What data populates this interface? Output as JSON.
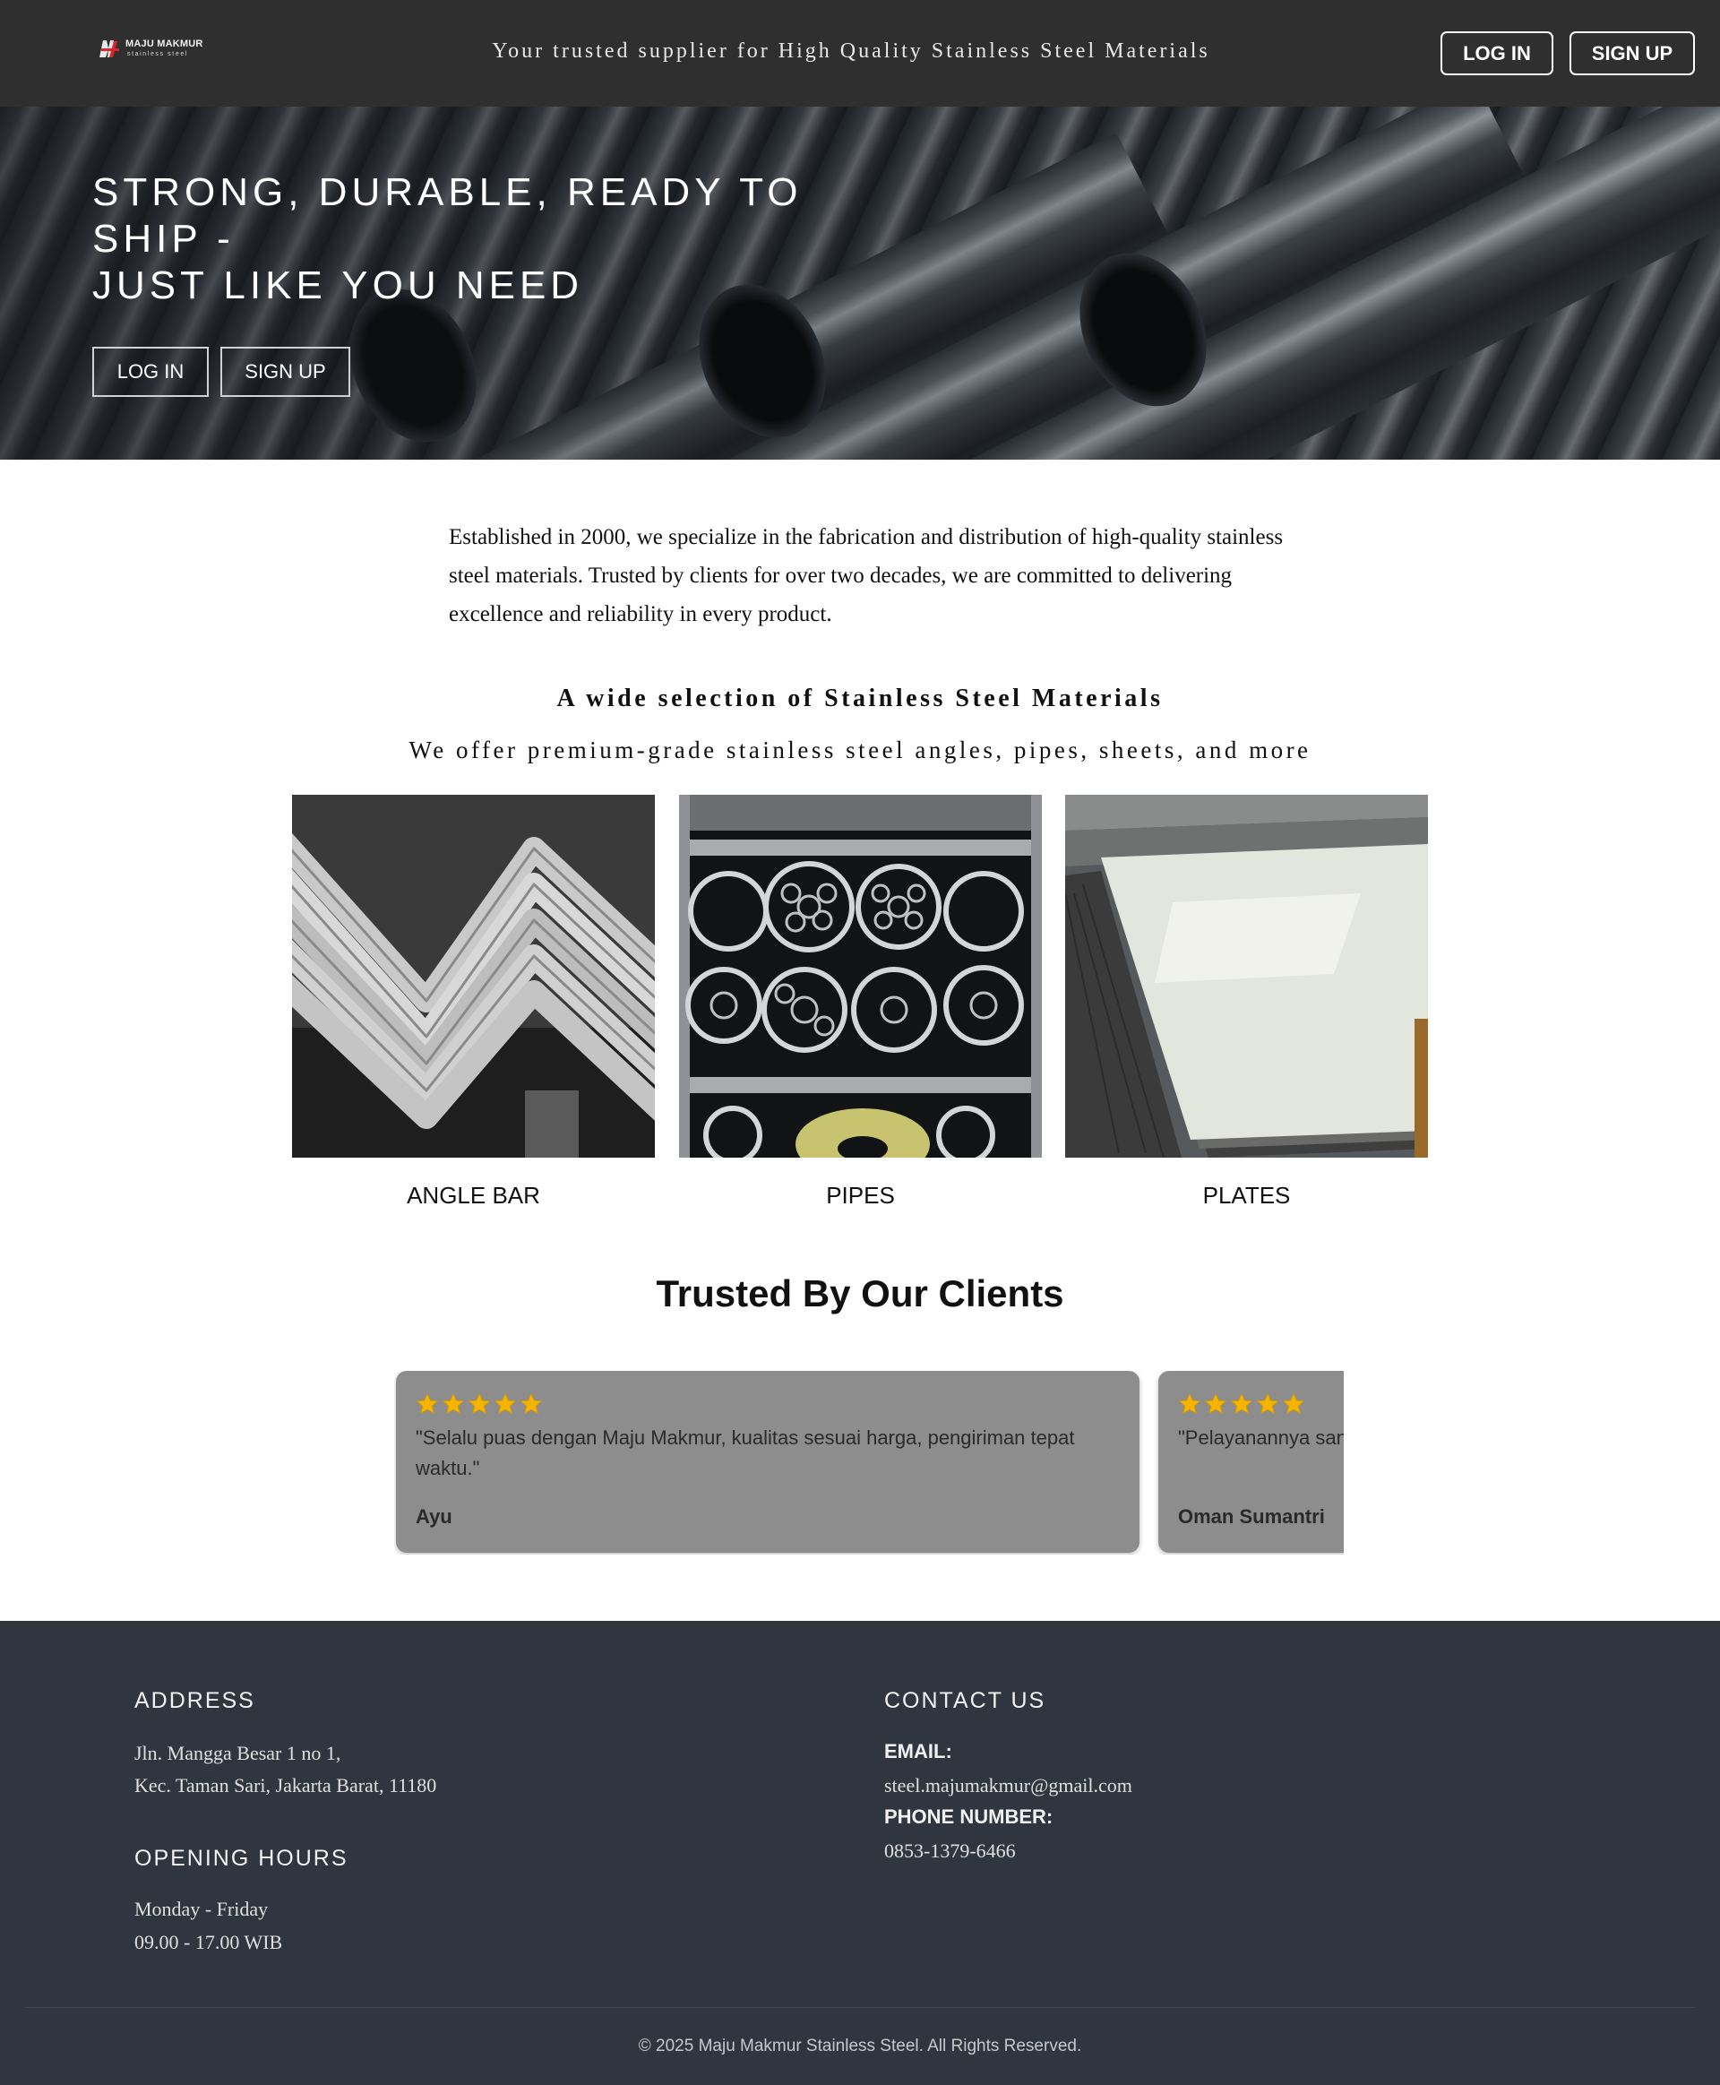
{
  "header": {
    "logo_brand": "MAJU MAKMUR",
    "logo_sub": "stainless steel",
    "tagline": "Your trusted supplier for High Quality Stainless Steel Materials",
    "login_label": "LOG IN",
    "signup_label": "SIGN UP"
  },
  "hero": {
    "headline_line1": "STRONG, DURABLE, READY TO",
    "headline_line2": "SHIP -",
    "headline_line3": "JUST LIKE YOU NEED",
    "login_label": "LOG IN",
    "signup_label": "SIGN UP"
  },
  "intro": {
    "text": "Established in 2000, we specialize in the fabrication and distribution of high-quality stainless steel materials. Trusted by clients for over two decades, we are committed to delivering excellence and reliability in every product."
  },
  "selection": {
    "title": "A wide selection of Stainless Steel Materials",
    "subtitle": "We offer premium-grade stainless steel angles, pipes, sheets, and more"
  },
  "products": [
    {
      "label": "ANGLE BAR"
    },
    {
      "label": "PIPES"
    },
    {
      "label": "PLATES"
    }
  ],
  "testimonials": {
    "title": "Trusted By Our Clients",
    "items": [
      {
        "rating": 5,
        "quote": "\"Selalu puas dengan Maju Makmur, kualitas sesuai harga, pengiriman tepat waktu.\"",
        "author": "Ayu"
      },
      {
        "rating": 5,
        "quote": "\"Pelayanannya sangat ramah dan harga sangat bersaing.\"",
        "author": "Oman Sumantri"
      }
    ],
    "star_color": "#f4b400"
  },
  "footer": {
    "address_title": "ADDRESS",
    "address_line1": "Jln. Mangga Besar 1 no 1,",
    "address_line2": "Kec. Taman Sari, Jakarta Barat, 11180",
    "hours_title": "OPENING HOURS",
    "hours_days": "Monday - Friday",
    "hours_time": "09.00 - 17.00 WIB",
    "contact_title": "CONTACT US",
    "email_label": "EMAIL:",
    "email_value": "steel.majumakmur@gmail.com",
    "phone_label": "PHONE NUMBER:",
    "phone_value": "0853-1379-6466",
    "copyright": "© 2025 Maju Makmur Stainless Steel. All Rights Reserved."
  },
  "colors": {
    "header_bg": "#2f2f2f",
    "footer_bg": "#2f3640",
    "card_bg": "#8d8d8d"
  }
}
